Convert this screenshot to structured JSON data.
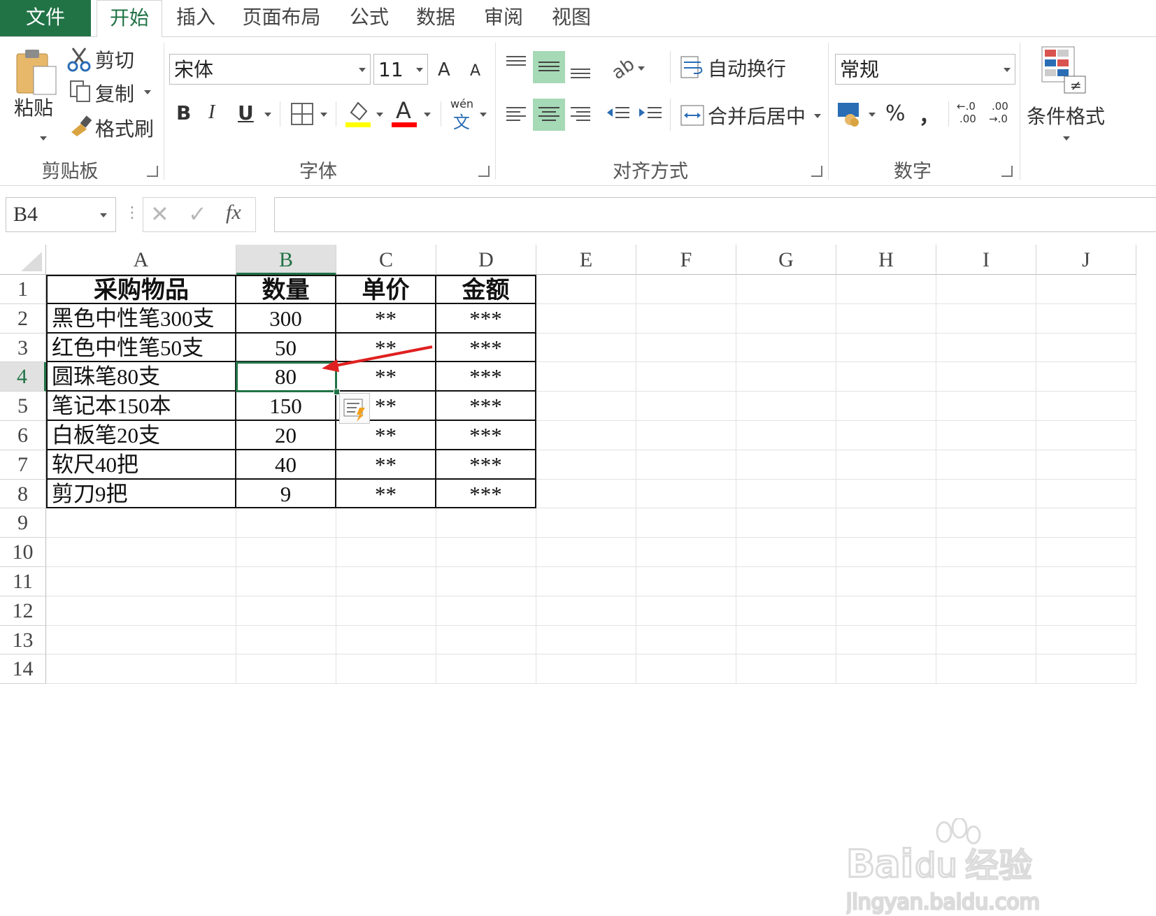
{
  "tabs": [
    "文件",
    "开始",
    "插入",
    "页面布局",
    "公式",
    "数据",
    "审阅",
    "视图"
  ],
  "active_tab": "开始",
  "ribbon": {
    "clipboard": {
      "paste": "粘贴",
      "cut": "剪切",
      "copy": "复制",
      "format_painter": "格式刷",
      "label": "剪贴板"
    },
    "font": {
      "name": "宋体",
      "size": "11",
      "grow": "A",
      "shrink": "A",
      "bold": "B",
      "italic": "I",
      "underline": "U",
      "font_color": "A",
      "phonetic_top": "wén",
      "phonetic_bottom": "文",
      "label": "字体",
      "fill_color": "#ffff00",
      "text_color": "#ff0000"
    },
    "alignment": {
      "wrap": "自动换行",
      "merge": "合并后居中",
      "label": "对齐方式"
    },
    "number": {
      "format": "常规",
      "percent": "%",
      "comma": "，",
      "inc_top": "←.0",
      "inc_bottom": ".00",
      "dec_top": ".00",
      "dec_bottom": "→.0",
      "label": "数字"
    },
    "styles": {
      "conditional": "条件格式"
    }
  },
  "formula_bar": {
    "name_box": "B4",
    "fx": "fx",
    "value": ""
  },
  "columns": [
    "A",
    "B",
    "C",
    "D",
    "E",
    "F",
    "G",
    "H",
    "I",
    "J"
  ],
  "rows": [
    "1",
    "2",
    "3",
    "4",
    "5",
    "6",
    "7",
    "8",
    "9",
    "10",
    "11",
    "12",
    "13",
    "14"
  ],
  "table": {
    "header": [
      "采购物品",
      "数量",
      "单价",
      "金额"
    ],
    "body": [
      [
        "黑色中性笔300支",
        "300",
        "**",
        "***"
      ],
      [
        "红色中性笔50支",
        "50",
        "**",
        "***"
      ],
      [
        "圆珠笔80支",
        "80",
        "**",
        "***"
      ],
      [
        "笔记本150本",
        "150",
        "**",
        "***"
      ],
      [
        "白板笔20支",
        "20",
        "**",
        "***"
      ],
      [
        "软尺40把",
        "40",
        "**",
        "***"
      ],
      [
        "剪刀9把",
        "9",
        "**",
        "***"
      ]
    ]
  },
  "selected_cell": "B4",
  "accent_color": "#217346",
  "annotation_arrow_color": "#e02020",
  "watermark": {
    "brand": "Bai du 经验",
    "url": "jingyan.baidu.com"
  }
}
